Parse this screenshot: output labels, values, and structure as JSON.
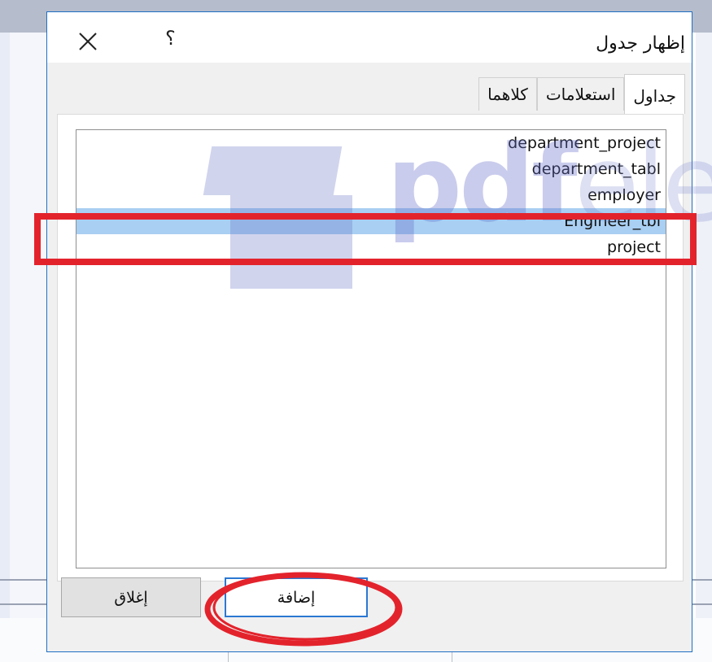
{
  "dialog": {
    "title": "إظهار جدول",
    "help_label": "؟",
    "tabs": [
      {
        "label": "جداول",
        "active": true
      },
      {
        "label": "استعلامات",
        "active": false
      },
      {
        "label": "كلاهما",
        "active": false
      }
    ],
    "tables": [
      {
        "name": "department_project",
        "selected": false
      },
      {
        "name": "department_tabl",
        "selected": false
      },
      {
        "name": "employer",
        "selected": false
      },
      {
        "name": "Engineer_tbl",
        "selected": true
      },
      {
        "name": "project",
        "selected": false
      }
    ],
    "buttons": {
      "add_label": "إضافة",
      "close_label": "إغلاق"
    }
  },
  "watermark": {
    "text_bold": "pdf",
    "text_light": "ele"
  },
  "colors": {
    "accent": "#2b78d2",
    "selection": "#a9cff2",
    "annotation": "#e3232c"
  },
  "icons": [
    "close-icon"
  ]
}
